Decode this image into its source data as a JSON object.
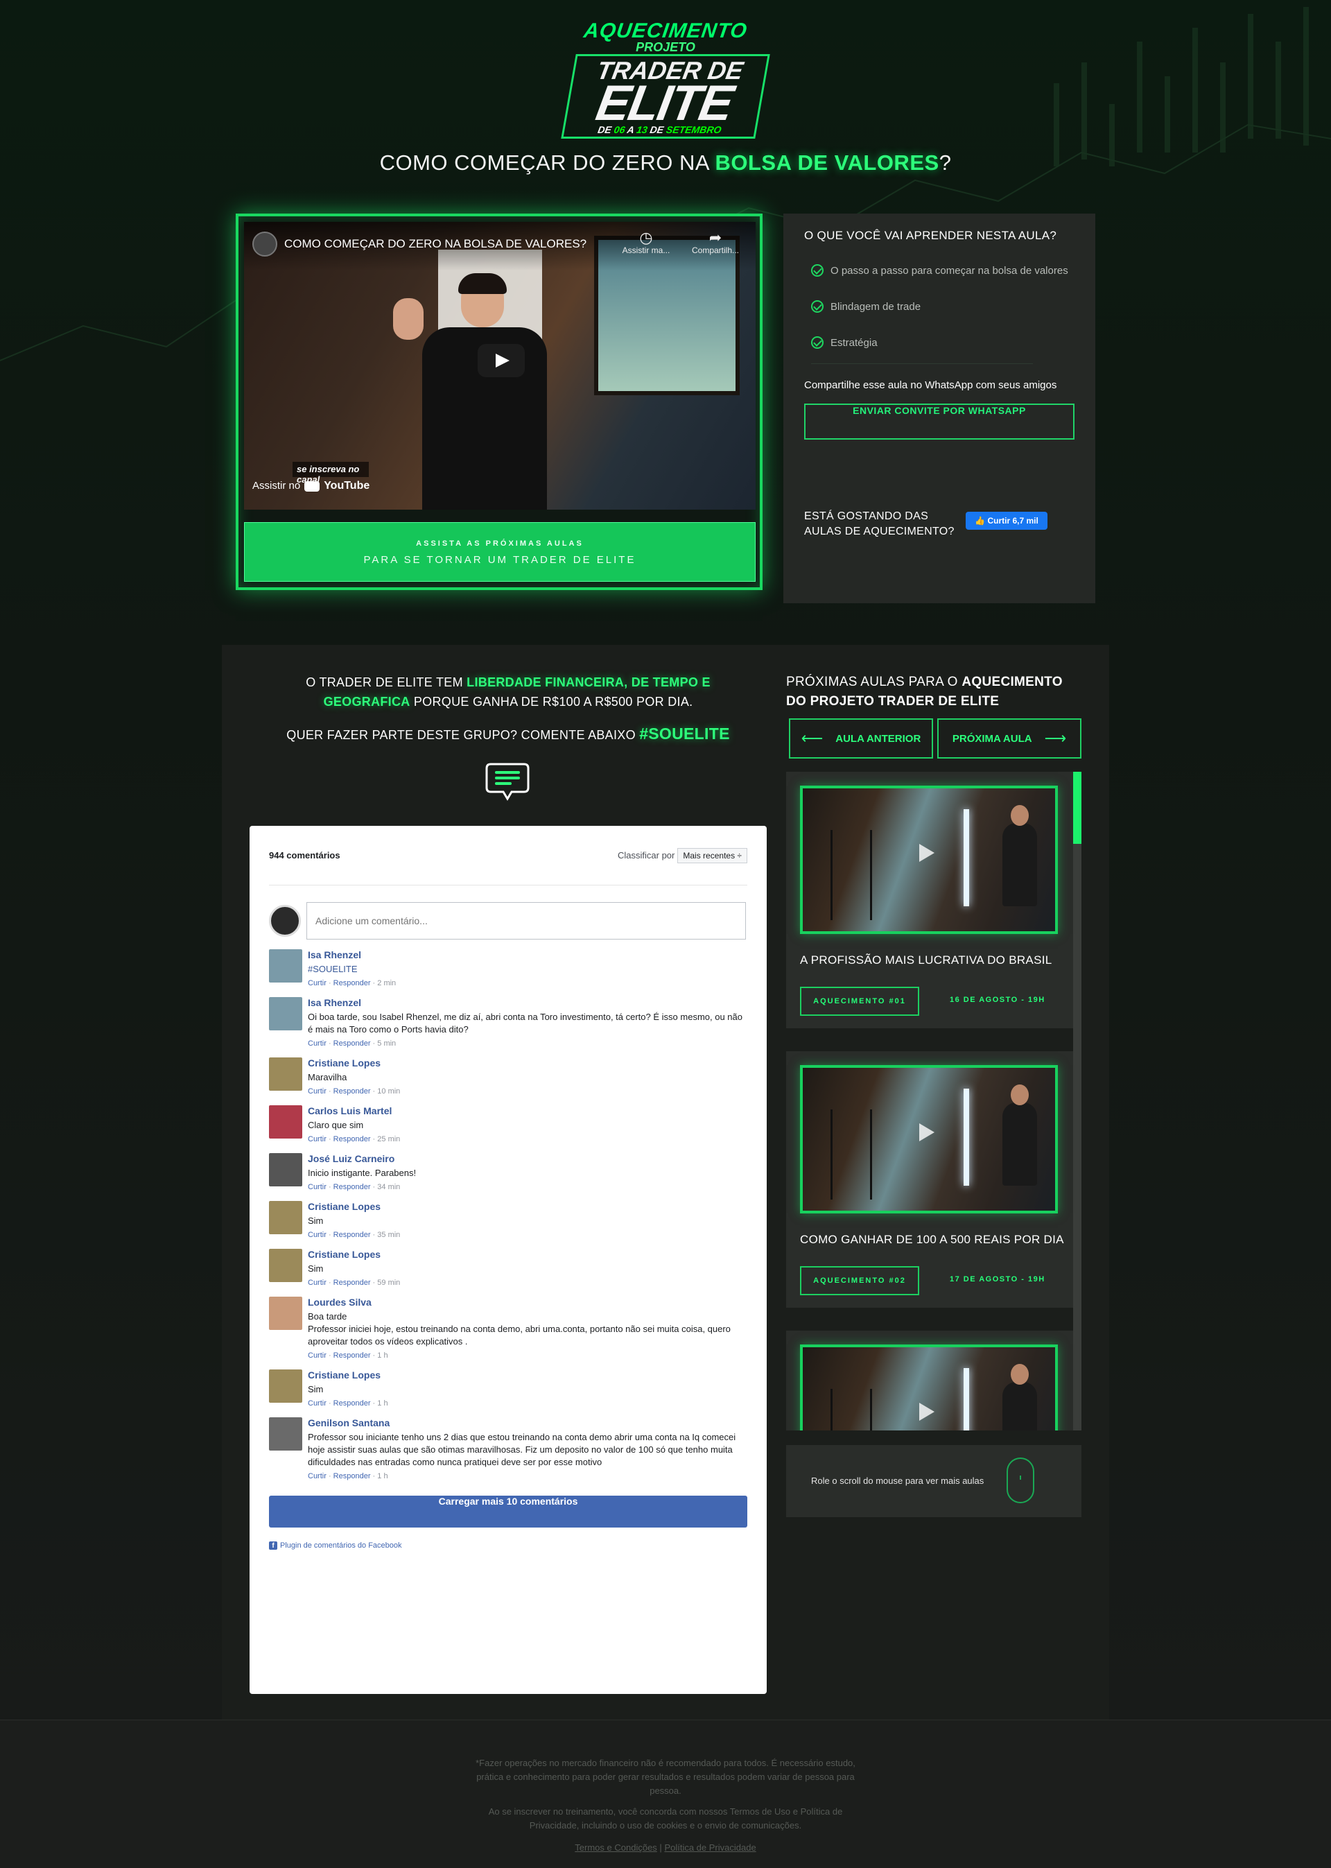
{
  "logo": {
    "line1": "AQUECIMENTO",
    "line2": "PROJETO",
    "line3": "TRADER DE",
    "line4": "ELITE",
    "date_de": "DE",
    "date_d1": "06",
    "date_a": "A",
    "date_d2": "13",
    "date_de2": "DE",
    "date_month": "SETEMBRO"
  },
  "headline": {
    "prefix": "COMO COMEÇAR DO ZERO NA ",
    "highlight": "BOLSA DE VALORES",
    "suffix": "?"
  },
  "video": {
    "title": "COMO COMEÇAR DO ZERO NA BOLSA DE VALORES?",
    "watch_later": "Assistir ma...",
    "share": "Compartilh...",
    "watch_on": "Assistir no",
    "youtube": "YouTube",
    "subscribe": "se inscreva no canal"
  },
  "cta": {
    "line1": "ASSISTA AS PRÓXIMAS AULAS",
    "line2": "PARA SE TORNAR UM TRADER DE ELITE"
  },
  "learn": {
    "title": "O QUE VOCÊ VAI APRENDER NESTA AULA?",
    "items": [
      "O passo a passo para começar na bolsa de valores",
      "Blindagem de trade",
      "Estratégia"
    ],
    "share_text": "Compartilhe esse aula no WhatsApp com seus amigos",
    "whatsapp_button": "ENVIAR CONVITE POR WHATSAPP",
    "liking_line1": "ESTÁ GOSTANDO DAS",
    "liking_line2": "AULAS DE AQUECIMENTO?",
    "like_button": "Curtir 6,7 mil"
  },
  "promo": {
    "p1_a": "O TRADER DE ELITE TEM ",
    "p1_b": "LIBERDADE FINANCEIRA, DE TEMPO E GEOGRAFICA",
    "p1_c": " PORQUE GANHA DE R$100 A R$500 POR DIA.",
    "p2_a": "QUER FAZER PARTE DESTE GRUPO? COMENTE ABAIXO ",
    "p2_b": "#SOUELITE"
  },
  "comments": {
    "count": "944 comentários",
    "sort_label": "Classificar por",
    "sort_value": "Mais recentes ÷",
    "placeholder": "Adicione um comentário...",
    "items": [
      {
        "name": "Isa Rhenzel",
        "text": "#SOUELITE",
        "time": "2 min"
      },
      {
        "name": "Isa Rhenzel",
        "text": "Oi boa tarde, sou Isabel Rhenzel, me diz aí, abri conta na Toro investimento, tá certo? É isso mesmo, ou não é mais na Toro como o Ports havia dito?",
        "time": "5 min"
      },
      {
        "name": "Cristiane Lopes",
        "text": "Maravilha",
        "time": "10 min"
      },
      {
        "name": "Carlos Luis Martel",
        "text": "Claro que sim",
        "time": "25 min"
      },
      {
        "name": "José Luiz Carneiro",
        "text": "Inicio instigante. Parabens!",
        "time": "34 min"
      },
      {
        "name": "Cristiane Lopes",
        "text": "Sim",
        "time": "35 min"
      },
      {
        "name": "Cristiane Lopes",
        "text": "Sim",
        "time": "59 min"
      },
      {
        "name": "Lourdes Silva",
        "text": "Boa tarde\nProfessor iniciei hoje, estou treinando na conta demo, abri uma.conta, portanto não sei muita coisa, quero aproveitar todos os vídeos explicativos .",
        "time": "1 h"
      },
      {
        "name": "Cristiane Lopes",
        "text": "Sim",
        "time": "1 h"
      },
      {
        "name": "Genilson Santana",
        "text": "Professor sou iniciante tenho uns 2 dias que estou treinando na conta demo abrir uma conta na Iq comecei hoje assistir suas aulas que são otimas maravilhosas. Fiz um deposito no valor de 100 só que tenho muita dificuldades nas entradas como nunca pratiquei deve ser por esse motivo",
        "time": "1 h"
      }
    ],
    "like": "Curtir",
    "reply": "Responder",
    "load_more": "Carregar mais 10 comentários",
    "plugin": "Plugin de comentários do Facebook"
  },
  "next": {
    "title_a": "PRÓXIMAS AULAS PARA O ",
    "title_b": "AQUECIMENTO DO PROJETO TRADER DE ELITE",
    "prev_button": "AULA ANTERIOR",
    "next_button": "PRÓXIMA AULA",
    "lessons": [
      {
        "title": "A PROFISSÃO MAIS LUCRATIVA DO BRASIL",
        "tag": "AQUECIMENTO #01",
        "date": "16 DE AGOSTO - 19H"
      },
      {
        "title": "COMO GANHAR DE 100 A 500 REAIS POR DIA",
        "tag": "AQUECIMENTO #02",
        "date": "17 DE AGOSTO - 19H"
      },
      {
        "title": "",
        "tag": "",
        "date": ""
      }
    ],
    "scroll_hint": "Role o scroll do mouse para ver mais aulas"
  },
  "footer": {
    "p1": "*Fazer operações no mercado financeiro não é recomendado para todos. É necessário estudo, prática e conhecimento para poder gerar resultados e resultados podem variar de pessoa para pessoa.",
    "p2": "Ao se inscrever no treinamento, você concorda com nossos Termos de Uso e Política de Privacidade, incluindo o uso de cookies e o envio de comunicações.",
    "terms": "Termos e Condições",
    "sep": "|",
    "privacy": "Política de Privacidade"
  },
  "colors": {
    "accent": "#2dff7b",
    "bg": "#0e1310",
    "panel": "#252825",
    "fb_blue": "#4267b2"
  }
}
